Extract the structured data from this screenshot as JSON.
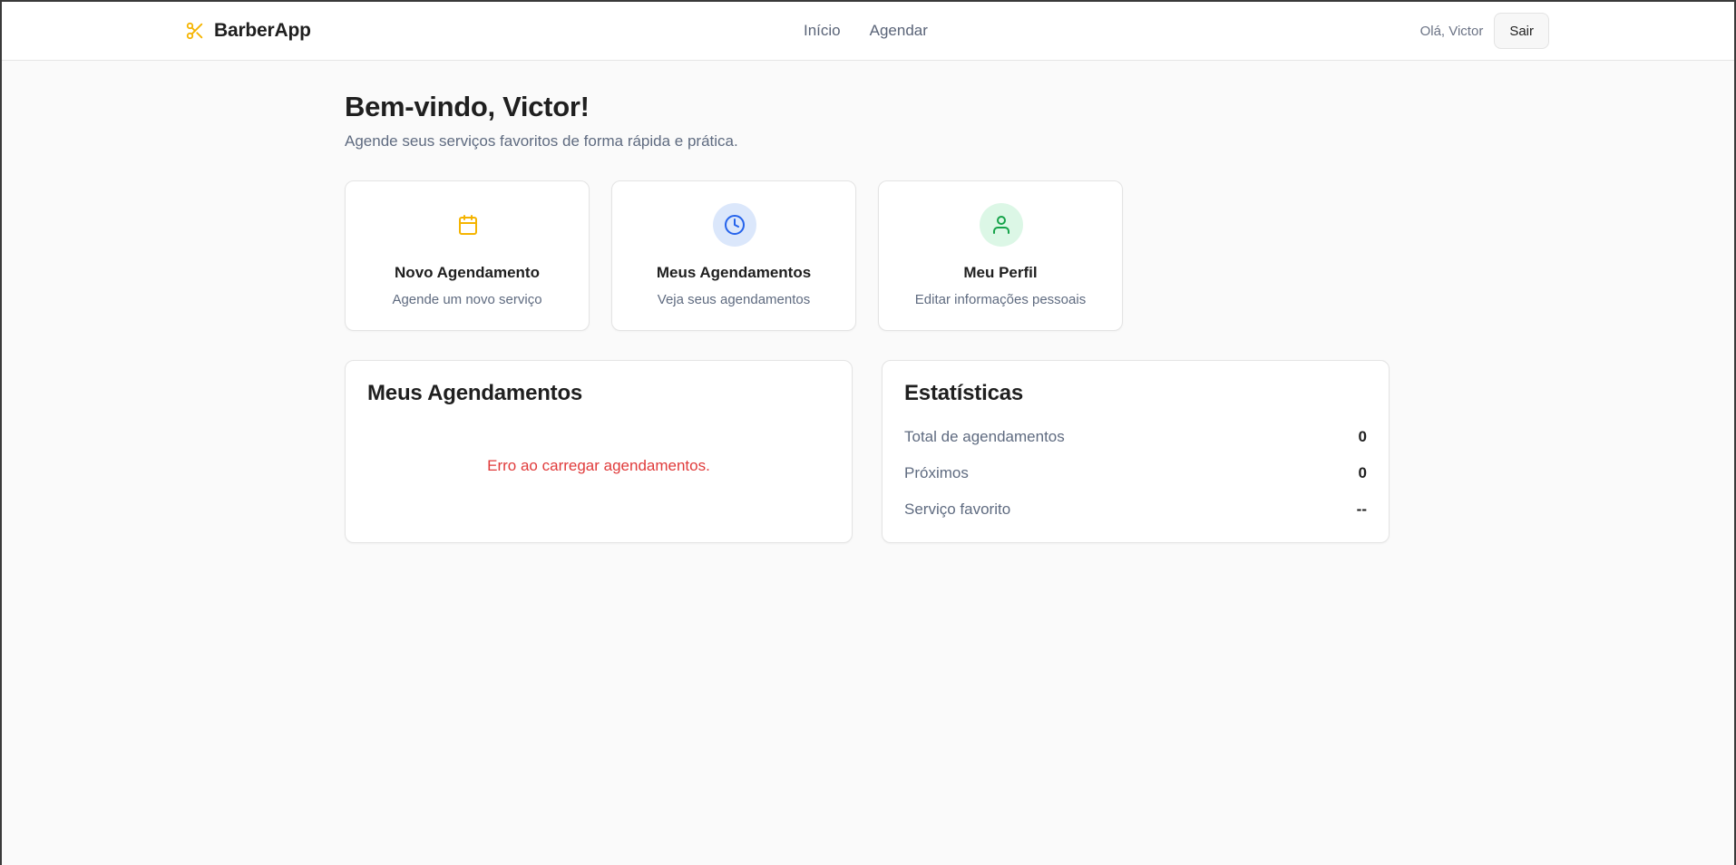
{
  "header": {
    "brand_name": "BarberApp",
    "brand_icon": "scissors-icon",
    "brand_color": "#f5b400",
    "nav": [
      {
        "label": "Início"
      },
      {
        "label": "Agendar"
      }
    ],
    "greeting": "Olá, Victor",
    "logout_label": "Sair"
  },
  "welcome": {
    "title": "Bem-vindo, Victor!",
    "subtitle": "Agende seus serviços favoritos de forma rápida e prática."
  },
  "action_cards": [
    {
      "title": "Novo Agendamento",
      "description": "Agende um novo serviço",
      "icon": "calendar-icon",
      "icon_color": "#f5b400",
      "icon_bg": "#ffffff"
    },
    {
      "title": "Meus Agendamentos",
      "description": "Veja seus agendamentos",
      "icon": "clock-icon",
      "icon_color": "#2563eb",
      "icon_bg": "#dbe7fb"
    },
    {
      "title": "Meu Perfil",
      "description": "Editar informações pessoais",
      "icon": "user-icon",
      "icon_color": "#16a34a",
      "icon_bg": "#dcf7e6"
    }
  ],
  "appointments_panel": {
    "title": "Meus Agendamentos",
    "error": "Erro ao carregar agendamentos.",
    "error_color": "#e03b3b"
  },
  "stats_panel": {
    "title": "Estatísticas",
    "rows": [
      {
        "label": "Total de agendamentos",
        "value": "0"
      },
      {
        "label": "Próximos",
        "value": "0"
      },
      {
        "label": "Serviço favorito",
        "value": "--"
      }
    ]
  }
}
